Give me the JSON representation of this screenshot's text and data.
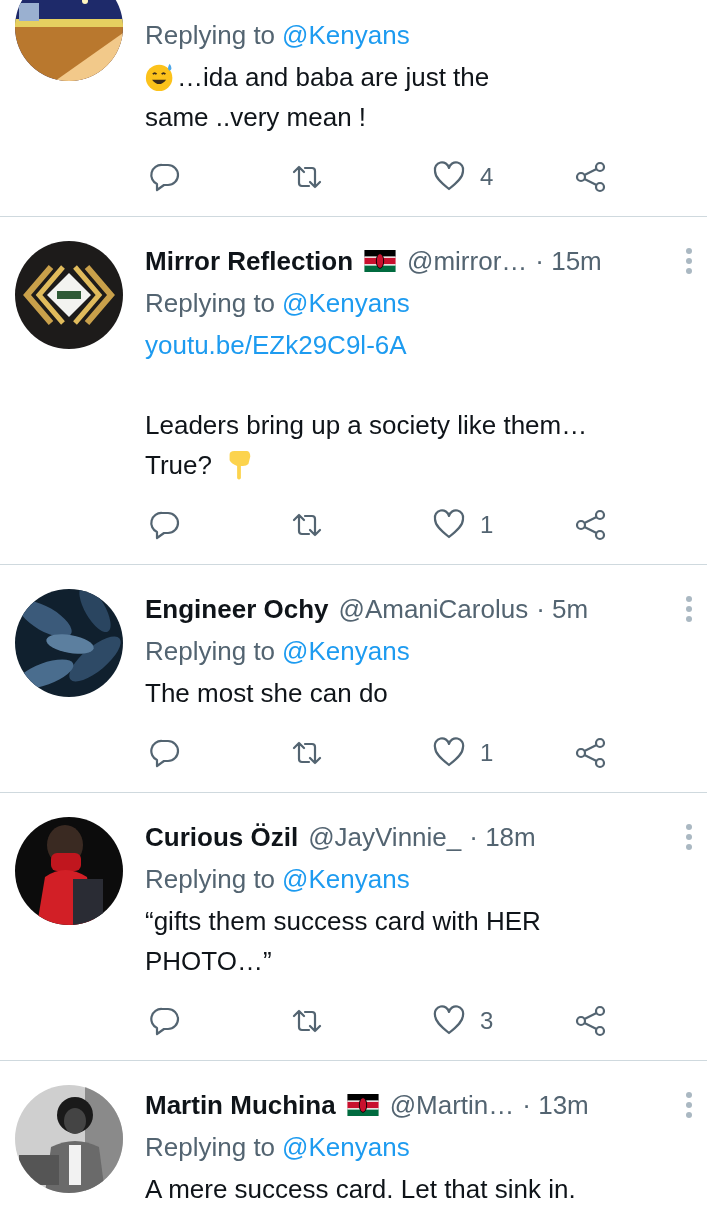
{
  "tweets": [
    {
      "replying_label": "Replying to",
      "replying_to": "@Kenyans",
      "body": [
        [
          {
            "kind": "emoji-smile"
          },
          {
            "kind": "text",
            "text": "…ida and baba are just the"
          }
        ],
        [
          {
            "kind": "text",
            "text": "same ..very mean !"
          }
        ]
      ],
      "likes": "4"
    },
    {
      "name": "Mirror Reflection",
      "flag": true,
      "handle": "@mirror…",
      "time": "· 15m",
      "replying_label": "Replying to",
      "replying_to": "@Kenyans",
      "body": [
        [
          {
            "kind": "link",
            "text": "youtu.be/EZk29C9l-6A"
          }
        ],
        [
          {
            "kind": "text",
            "text": "Leaders bring up a society like them…"
          }
        ],
        [
          {
            "kind": "text",
            "text": "True?"
          },
          {
            "kind": "emoji-point"
          }
        ]
      ],
      "likes": "1"
    },
    {
      "name": "Engineer Ochy",
      "flag": false,
      "handle": "@AmaniCarolus",
      "time": "· 5m",
      "replying_label": "Replying to",
      "replying_to": "@Kenyans",
      "body": [
        [
          {
            "kind": "text",
            "text": "The most she can do"
          }
        ]
      ],
      "likes": "1"
    },
    {
      "name": "Curious Özil",
      "flag": false,
      "handle": "@JayVinnie_",
      "time": "· 18m",
      "replying_label": "Replying to",
      "replying_to": "@Kenyans",
      "body": [
        [
          {
            "kind": "text",
            "text": "“gifts them success card with HER"
          }
        ],
        [
          {
            "kind": "text",
            "text": "PHOTO…”"
          }
        ]
      ],
      "likes": "3"
    },
    {
      "name": "Martin Muchina",
      "flag": true,
      "handle": "@Martin…",
      "time": "· 13m",
      "replying_label": "Replying to",
      "replying_to": "@Kenyans",
      "body": [
        [
          {
            "kind": "text",
            "text": "A mere success card. Let that sink in."
          }
        ]
      ]
    }
  ]
}
